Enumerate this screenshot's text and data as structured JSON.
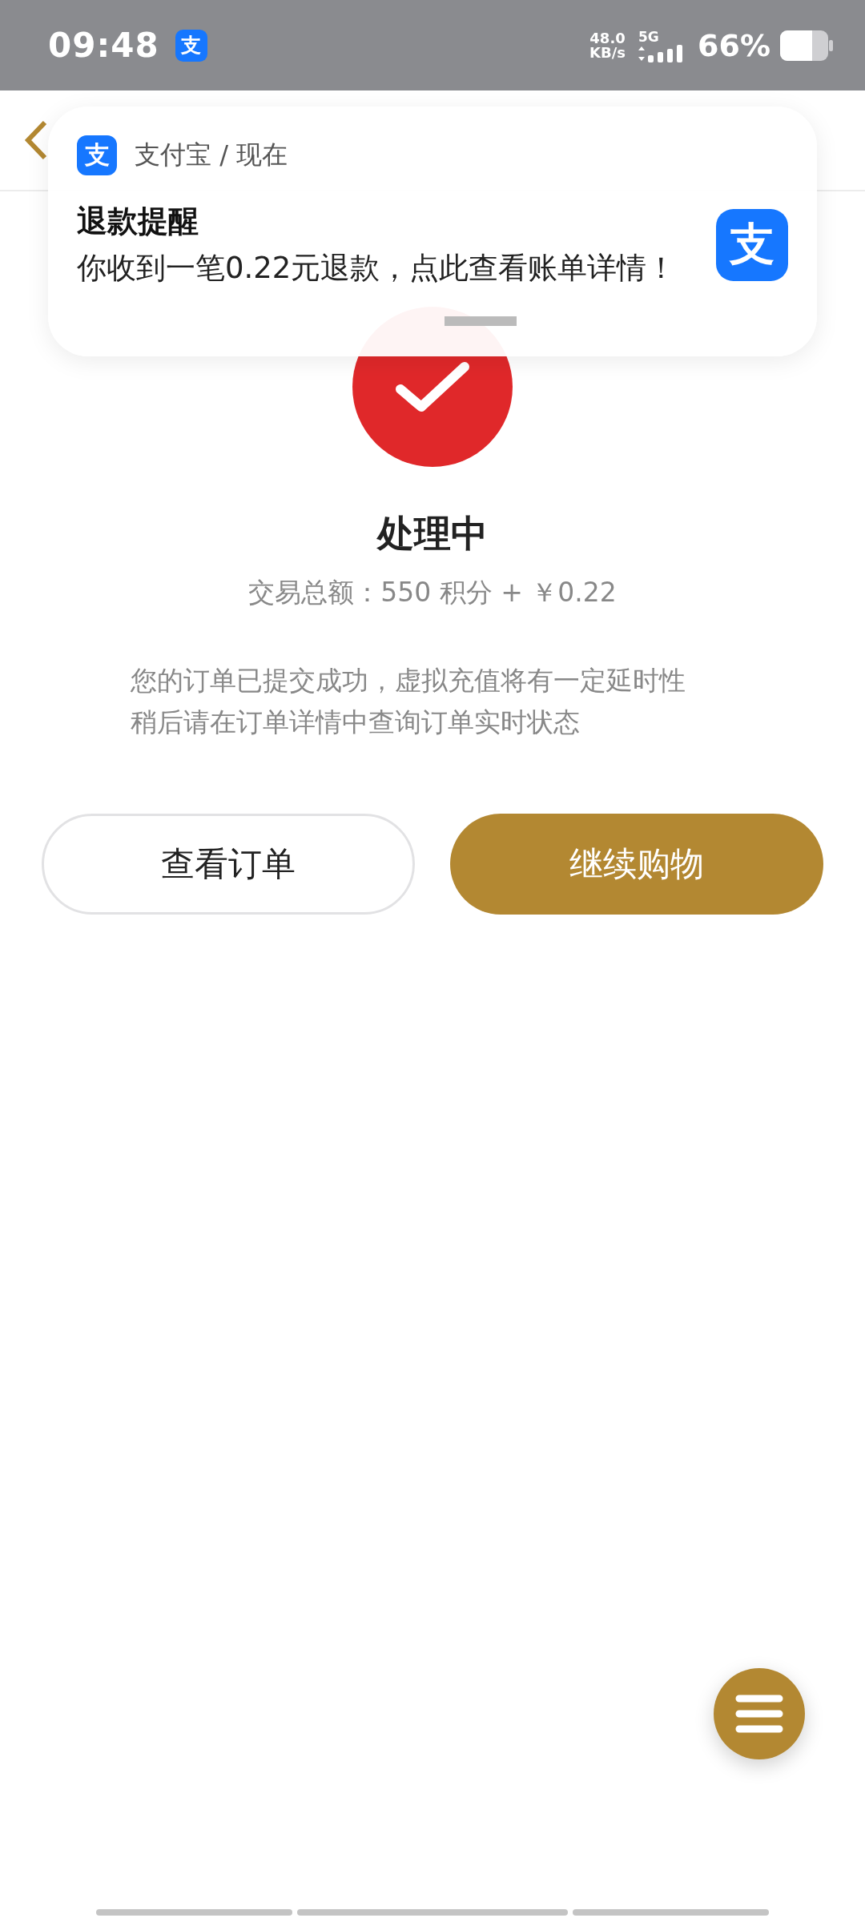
{
  "status_bar": {
    "time": "09:48",
    "app_icon": "支",
    "network_speed": "48.0",
    "speed_unit": "KB/s",
    "network_type": "5G",
    "battery": "66%"
  },
  "notification": {
    "app_icon": "支",
    "source": "支付宝 / 现在",
    "title": "退款提醒",
    "message": "你收到一笔0.22元退款，点此查看账单详情！",
    "large_icon": "支"
  },
  "result": {
    "status": "处理中",
    "amount": "交易总额：550 积分 + ￥0.22",
    "notes": [
      "您的订单已提交成功，虚拟充值将有一定延时性",
      "稍后请在订单详情中查询订单实时状态"
    ]
  },
  "buttons": [
    {
      "label": "查看订单",
      "kind": "outline"
    },
    {
      "label": "继续购物",
      "kind": "primary"
    }
  ]
}
